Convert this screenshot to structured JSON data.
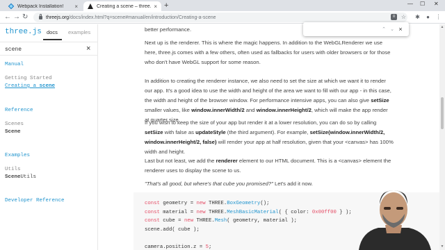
{
  "browser": {
    "tabs": [
      {
        "title": "Webpack Installation!",
        "close": "×",
        "favicon": "webpack-favicon"
      },
      {
        "title": "Creating a scene – three.js docs",
        "close": "×",
        "favicon": "threejs-favicon"
      }
    ],
    "new_tab": "+",
    "url_host": "threejs.org",
    "url_path": "/docs/index.html?q=scene#manual/en/introduction/Creating-a-scene",
    "find": {
      "value": "",
      "prev": "⌃",
      "next": "⌄",
      "close": "×"
    }
  },
  "sidebar": {
    "brand": "three.js",
    "tabs": {
      "docs": "docs",
      "examples": "examples"
    },
    "search_value": "scene",
    "clear": "×",
    "sections": [
      {
        "heading": "Manual",
        "groups": [
          {
            "title": "Getting Started",
            "items": [
              {
                "pre": "Creating a ",
                "match": "scene",
                "post": ""
              }
            ]
          }
        ]
      },
      {
        "heading": "Reference",
        "groups": [
          {
            "title": "Scenes",
            "items": [
              {
                "pre": "",
                "match": "Scene",
                "post": ""
              }
            ]
          }
        ]
      },
      {
        "heading": "Examples",
        "groups": [
          {
            "title": "Utils",
            "items": [
              {
                "pre": "",
                "match": "Scene",
                "post": "Utils"
              }
            ]
          }
        ]
      },
      {
        "heading": "Developer Reference",
        "groups": []
      }
    ]
  },
  "content": {
    "p0": "better performance.",
    "p1": "Next up is the renderer. This is where the magic happens. In addition to the WebGLRenderer we use here, three.js comes with a few others, often used as fallbacks for users with older browsers or for those who don't have WebGL support for some reason.",
    "p2_a": "In addition to creating the renderer instance, we also need to set the size at which we want it to render our app. It's a good idea to use the width and height of the area we want to fill with our app - in this case, the width and height of the browser window. For performance intensive apps, you can also give ",
    "p2_b1": "setSize",
    "p2_c": " smaller values, like ",
    "p2_b2": "window.innerWidth/2",
    "p2_d": " and ",
    "p2_b3": "window.innerHeight/2",
    "p2_e": ", which will make the app render at quarter size.",
    "p3_a": "If you wish to keep the size of your app but render it at a lower resolution, you can do so by calling ",
    "p3_b1": "setSize",
    "p3_c": " with false as ",
    "p3_b2": "updateStyle",
    "p3_d": " (the third argument). For example, ",
    "p3_b3": "setSize(window.innerWidth/2, window.innerHeight/2, false)",
    "p3_e": " will render your app at half resolution, given that your <canvas> has 100% width and height.",
    "p4_a": "Last but not least, we add the ",
    "p4_b": "renderer",
    "p4_c": " element to our HTML document. This is a <canvas> element the renderer uses to display the scene to us.",
    "p5_quote": "\"That's all good, but where's that cube you promised?\"",
    "p5_rest": " Let's add it now.",
    "code": [
      [
        {
          "t": "const",
          "c": "kw"
        },
        {
          "t": " geometry = ",
          "c": ""
        },
        {
          "t": "new",
          "c": "kw"
        },
        {
          "t": " THREE.",
          "c": ""
        },
        {
          "t": "BoxGeometry",
          "c": "fn"
        },
        {
          "t": "();",
          "c": ""
        }
      ],
      [
        {
          "t": "const",
          "c": "kw"
        },
        {
          "t": " material = ",
          "c": ""
        },
        {
          "t": "new",
          "c": "kw"
        },
        {
          "t": " THREE.",
          "c": ""
        },
        {
          "t": "MeshBasicMaterial",
          "c": "fn"
        },
        {
          "t": "( { color: ",
          "c": ""
        },
        {
          "t": "0x00ff00",
          "c": "num"
        },
        {
          "t": " } );",
          "c": ""
        }
      ],
      [
        {
          "t": "const",
          "c": "kw"
        },
        {
          "t": " cube = ",
          "c": ""
        },
        {
          "t": "new",
          "c": "kw"
        },
        {
          "t": " THREE.",
          "c": ""
        },
        {
          "t": "Mesh",
          "c": "fn"
        },
        {
          "t": "( geometry, material );",
          "c": ""
        }
      ],
      [
        {
          "t": "scene.add( cube );",
          "c": ""
        }
      ],
      [
        {
          "t": "",
          "c": ""
        }
      ],
      [
        {
          "t": "camera.position.z = ",
          "c": ""
        },
        {
          "t": "5",
          "c": "num"
        },
        {
          "t": ";",
          "c": ""
        }
      ]
    ]
  },
  "colors": {
    "accent": "#2194ce",
    "keyword": "#e44c65"
  }
}
